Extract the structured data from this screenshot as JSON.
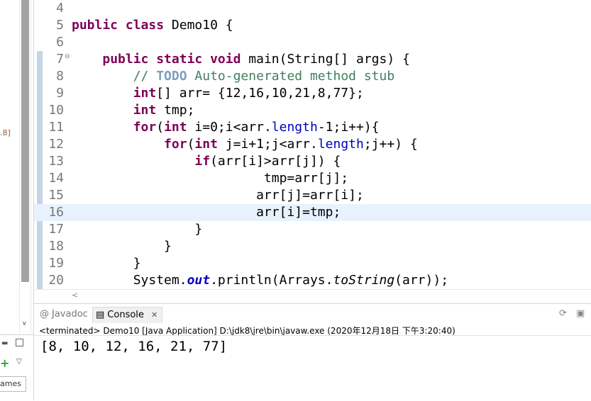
{
  "left_panel": {
    "fragment_text": ".8]",
    "names_text": "ames"
  },
  "editor": {
    "lines": [
      {
        "num": "4",
        "segments": []
      },
      {
        "num": "5",
        "segments": [
          [
            "kw",
            "public "
          ],
          [
            "kw",
            "class "
          ],
          [
            "pl",
            "Demo10 {"
          ]
        ]
      },
      {
        "num": "6",
        "segments": []
      },
      {
        "num": "7",
        "fold": true,
        "segments": [
          [
            "pl",
            "    "
          ],
          [
            "kw",
            "public "
          ],
          [
            "kw",
            "static "
          ],
          [
            "kw",
            "void "
          ],
          [
            "pl",
            "main(String[] args) {"
          ]
        ]
      },
      {
        "num": "8",
        "segments": [
          [
            "pl",
            "        "
          ],
          [
            "cm",
            "// "
          ],
          [
            "todo",
            "TODO"
          ],
          [
            "cm",
            " Auto-generated method stub"
          ]
        ]
      },
      {
        "num": "9",
        "segments": [
          [
            "pl",
            "        "
          ],
          [
            "kw",
            "int"
          ],
          [
            "pl",
            "[] arr= {12,16,10,21,8,77};"
          ]
        ]
      },
      {
        "num": "10",
        "segments": [
          [
            "pl",
            "        "
          ],
          [
            "kw",
            "int "
          ],
          [
            "pl",
            "tmp;"
          ]
        ]
      },
      {
        "num": "11",
        "segments": [
          [
            "pl",
            "        "
          ],
          [
            "kw",
            "for"
          ],
          [
            "pl",
            "("
          ],
          [
            "kw",
            "int "
          ],
          [
            "pl",
            "i=0;i<arr."
          ],
          [
            "fld",
            "length"
          ],
          [
            "pl",
            "-1;i++){"
          ]
        ]
      },
      {
        "num": "12",
        "segments": [
          [
            "pl",
            "            "
          ],
          [
            "kw",
            "for"
          ],
          [
            "pl",
            "("
          ],
          [
            "kw",
            "int "
          ],
          [
            "pl",
            "j=i+1;j<arr."
          ],
          [
            "fld",
            "length"
          ],
          [
            "pl",
            ";j++) {"
          ]
        ]
      },
      {
        "num": "13",
        "segments": [
          [
            "pl",
            "                "
          ],
          [
            "kw",
            "if"
          ],
          [
            "pl",
            "(arr[i]>arr[j]) {"
          ]
        ]
      },
      {
        "num": "14",
        "segments": [
          [
            "pl",
            "                         tmp=arr[j];"
          ]
        ]
      },
      {
        "num": "15",
        "segments": [
          [
            "pl",
            "                        arr[j]=arr[i];"
          ]
        ]
      },
      {
        "num": "16",
        "current": true,
        "segments": [
          [
            "pl",
            "                        arr[i]=tmp;"
          ]
        ]
      },
      {
        "num": "17",
        "segments": [
          [
            "pl",
            "                }"
          ]
        ]
      },
      {
        "num": "18",
        "segments": [
          [
            "pl",
            "            }"
          ]
        ]
      },
      {
        "num": "19",
        "segments": [
          [
            "pl",
            "        }"
          ]
        ]
      },
      {
        "num": "20",
        "segments": [
          [
            "pl",
            "        System."
          ],
          [
            "sfld",
            "out"
          ],
          [
            "pl",
            ".println(Arrays."
          ],
          [
            "smt",
            "toString"
          ],
          [
            "pl",
            "(arr));"
          ]
        ]
      }
    ]
  },
  "console": {
    "tabs": {
      "javadoc": "Javadoc",
      "console": "Console",
      "close": "✕"
    },
    "status": "<terminated> Demo10 [Java Application] D:\\jdk8\\jre\\bin\\javaw.exe (2020年12月18日 下午3:20:40)",
    "output": "[8, 10, 12, 16, 21, 77]"
  }
}
